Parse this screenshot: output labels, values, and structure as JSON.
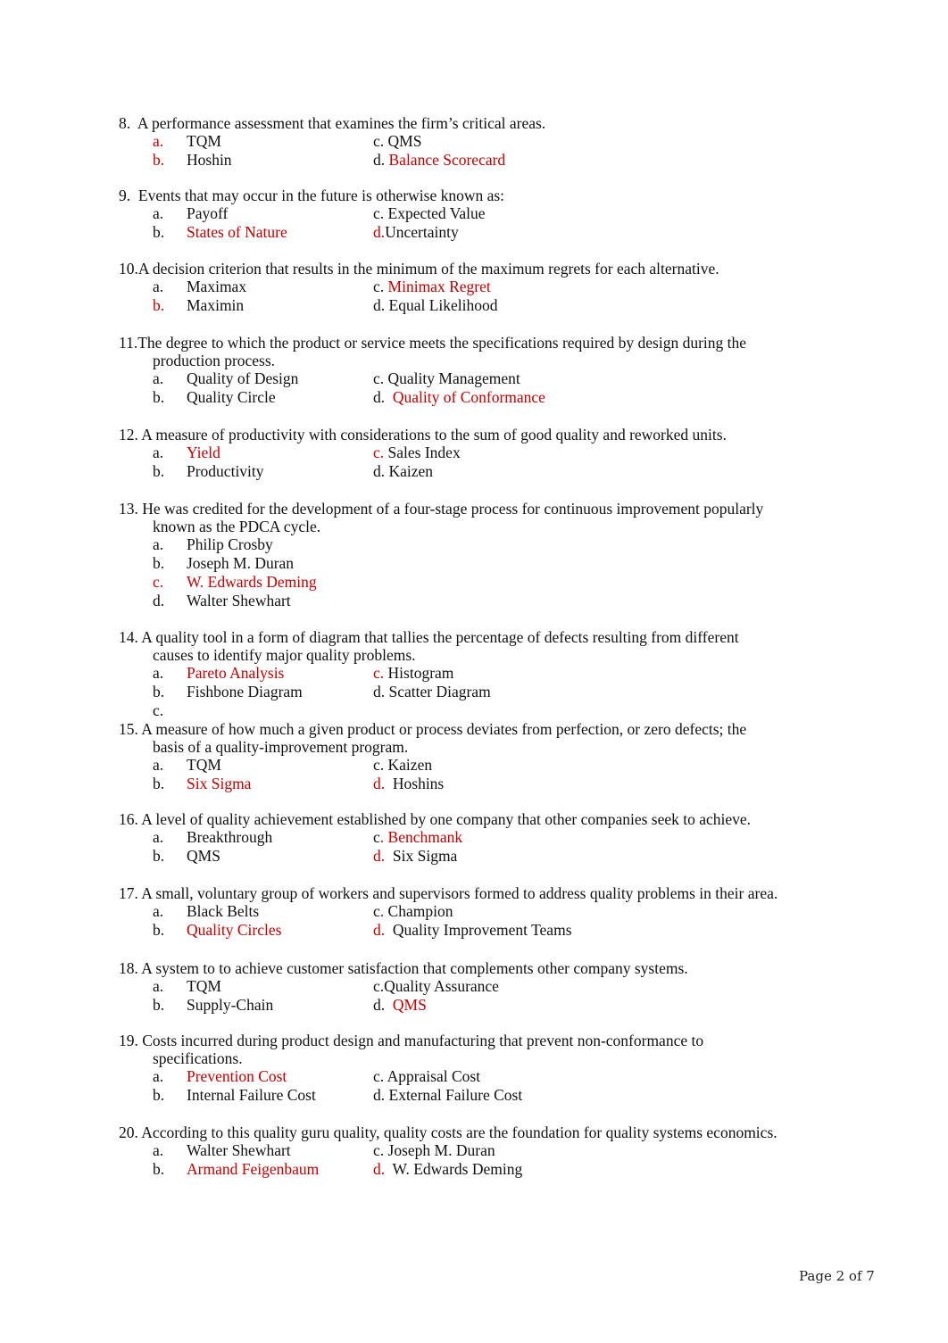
{
  "questions": [
    {
      "number": "8.",
      "stem_line1": "  A performance assessment that examines the firm’s critical areas.",
      "stem_line2": "",
      "options": [
        {
          "marker": "a.",
          "marker_color": "red",
          "text": "TQM",
          "text_color": "black",
          "col": "left"
        },
        {
          "marker": "c.",
          "marker_color": "black",
          "text": " QMS",
          "text_color": "black",
          "col": "right"
        },
        {
          "marker": "b.",
          "marker_color": "red",
          "text": "Hoshin",
          "text_color": "black",
          "col": "left"
        },
        {
          "marker": "d.",
          "marker_color": "black",
          "text": " Balance Scorecard",
          "text_color": "red",
          "col": "right"
        }
      ]
    },
    {
      "number": "9.",
      "stem_line1": "  Events that may occur in the future is otherwise known as:",
      "stem_line2": "",
      "options": [
        {
          "marker": "a.",
          "marker_color": "black",
          "text": "Payoff",
          "text_color": "black"
        },
        {
          "marker": "c.",
          "marker_color": "black",
          "text": " Expected Value",
          "text_color": "black"
        },
        {
          "marker": "b.",
          "marker_color": "black",
          "text": "States of Nature",
          "text_color": "red"
        },
        {
          "marker": "d.",
          "marker_color": "red",
          "text": "Uncertainty",
          "text_color": "black"
        }
      ]
    },
    {
      "number": "10.",
      "stem_line1": "A decision criterion that results in the minimum of the maximum regrets for each alternative.",
      "stem_line2": "",
      "options": [
        {
          "marker": "a.",
          "marker_color": "black",
          "text": "Maximax",
          "text_color": "black"
        },
        {
          "marker": "c.",
          "marker_color": "black",
          "text": " Minimax Regret",
          "text_color": "red"
        },
        {
          "marker": "b.",
          "marker_color": "red",
          "text": "Maximin",
          "text_color": "black"
        },
        {
          "marker": "d.",
          "marker_color": "black",
          "text": " Equal Likelihood",
          "text_color": "black"
        }
      ]
    },
    {
      "number": "11.",
      "stem_line1": "The degree to which the product or service meets the specifications required by design during the",
      "stem_line2": "production process.",
      "options": [
        {
          "marker": "a.",
          "marker_color": "black",
          "text": "Quality of Design",
          "text_color": "black"
        },
        {
          "marker": "c.",
          "marker_color": "black",
          "text": " Quality Management",
          "text_color": "black"
        },
        {
          "marker": "b.",
          "marker_color": "black",
          "text": "Quality Circle",
          "text_color": "black"
        },
        {
          "marker": "d.",
          "marker_color": "black",
          "text": "  Quality of Conformance",
          "text_color": "red"
        }
      ]
    },
    {
      "number": "12.",
      "stem_line1": " A measure of productivity with considerations to the sum of good quality and reworked units.",
      "stem_line2": "",
      "options": [
        {
          "marker": "a.",
          "marker_color": "black",
          "text": "Yield",
          "text_color": "red"
        },
        {
          "marker": "c.",
          "marker_color": "red",
          "text": " Sales Index",
          "text_color": "black"
        },
        {
          "marker": "b.",
          "marker_color": "black",
          "text": "Productivity",
          "text_color": "black"
        },
        {
          "marker": "d.",
          "marker_color": "black",
          "text": " Kaizen",
          "text_color": "black"
        }
      ]
    },
    {
      "number": "13.",
      "stem_line1": " He was credited for the development of a four-stage process for continuous improvement popularly",
      "stem_line2": "known as the PDCA cycle.",
      "options": [
        {
          "marker": "a.",
          "marker_color": "black",
          "text": "Philip Crosby",
          "text_color": "black"
        },
        {
          "marker": "b.",
          "marker_color": "black",
          "text": "Joseph M. Duran",
          "text_color": "black"
        },
        {
          "marker": "c.",
          "marker_color": "red",
          "text": "W. Edwards Deming",
          "text_color": "red"
        },
        {
          "marker": "d.",
          "marker_color": "black",
          "text": "Walter Shewhart",
          "text_color": "black"
        }
      ]
    },
    {
      "number": "14.",
      "stem_line1": " A quality tool in a form of diagram that tallies the percentage of defects resulting from different",
      "stem_line2": "causes to identify major quality problems.",
      "options": [
        {
          "marker": "a.",
          "marker_color": "black",
          "text": "Pareto Analysis",
          "text_color": "red"
        },
        {
          "marker": "c.",
          "marker_color": "red",
          "text": " Histogram",
          "text_color": "black"
        },
        {
          "marker": "b.",
          "marker_color": "black",
          "text": "Fishbone Diagram",
          "text_color": "black"
        },
        {
          "marker": "d.",
          "marker_color": "black",
          "text": " Scatter Diagram",
          "text_color": "black"
        },
        {
          "marker": "c.",
          "marker_color": "black",
          "text": "",
          "text_color": "black"
        }
      ]
    },
    {
      "number": "15.",
      "stem_line1": " A measure of how much a given product or process deviates from perfection, or zero defects; the",
      "stem_line2": "basis of a quality-improvement program.",
      "options": [
        {
          "marker": "a.",
          "marker_color": "black",
          "text": "TQM",
          "text_color": "black"
        },
        {
          "marker": "c.",
          "marker_color": "black",
          "text": " Kaizen",
          "text_color": "black"
        },
        {
          "marker": "b.",
          "marker_color": "black",
          "text": "Six Sigma",
          "text_color": "red"
        },
        {
          "marker": "d.",
          "marker_color": "red",
          "text": "  Hoshins",
          "text_color": "black"
        }
      ]
    },
    {
      "number": "16.",
      "stem_line1": " A level of quality achievement established by one company that other companies seek to achieve.",
      "stem_line2": "",
      "options": [
        {
          "marker": "a.",
          "marker_color": "black",
          "text": "Breakthrough",
          "text_color": "black"
        },
        {
          "marker": "c",
          "marker_suffix": ".",
          "marker_color": "black",
          "text": " Benchmank",
          "text_color": "red"
        },
        {
          "marker": "b.",
          "marker_color": "black",
          "text": "QMS",
          "text_color": "black"
        },
        {
          "marker": "d.",
          "marker_color": "red",
          "text": "  Six Sigma",
          "text_color": "black"
        }
      ]
    },
    {
      "number": "17.",
      "stem_line1": " A small, voluntary group of workers and supervisors formed to address quality problems in their area.",
      "stem_line2": "",
      "options": [
        {
          "marker": "a.",
          "marker_color": "black",
          "text": "Black Belts",
          "text_color": "black"
        },
        {
          "marker": "c",
          "marker_suffix": ".",
          "marker_color": "black",
          "text": " Champion",
          "text_color": "black"
        },
        {
          "marker": "b.",
          "marker_color": "black",
          "text": "Quality Circles",
          "text_color": "red"
        },
        {
          "marker": "d.",
          "marker_color": "red",
          "text": "  Quality Improvement Teams",
          "text_color": "black"
        }
      ]
    },
    {
      "number": "18.",
      "stem_line1": " A system to to achieve customer satisfaction that complements other company systems.",
      "stem_line2": "",
      "options": [
        {
          "marker": "a.",
          "marker_color": "black",
          "text": "TQM",
          "text_color": "black"
        },
        {
          "marker": "c.",
          "marker_color": "black",
          "text": "Quality Assurance",
          "text_color": "black"
        },
        {
          "marker": "b.",
          "marker_color": "black",
          "text": "Supply-Chain",
          "text_color": "black"
        },
        {
          "marker": "d.",
          "marker_color": "black",
          "text": "  QMS",
          "text_color": "red"
        }
      ]
    },
    {
      "number": "19.",
      "stem_line1": " Costs incurred during product design and manufacturing that prevent non-conformance to",
      "stem_line2": "specifications.",
      "options": [
        {
          "marker": "a.",
          "marker_color": "black",
          "text": "Prevention Cost",
          "text_color": "red"
        },
        {
          "marker": "c.",
          "marker_color": "black",
          "text": " Appraisal Cost",
          "text_color": "black"
        },
        {
          "marker": "b.",
          "marker_color": "black",
          "text": "Internal Failure Cost",
          "text_color": "black"
        },
        {
          "marker": "d.",
          "marker_color": "black",
          "text": " External Failure Cost",
          "text_color": "black"
        }
      ]
    },
    {
      "number": "20.",
      "stem_line1": " According to this quality guru quality, quality costs are the foundation for quality systems economics.",
      "stem_line2": "",
      "options": [
        {
          "marker": "a.",
          "marker_color": "black",
          "text": "Walter Shewhart",
          "text_color": "black"
        },
        {
          "marker": "c.",
          "marker_color": "black",
          "text": " Joseph M. Duran",
          "text_color": "black"
        },
        {
          "marker": "b.",
          "marker_color": "black",
          "text": "Armand Feigenbaum",
          "text_color": "red"
        },
        {
          "marker": "d.",
          "marker_color": "red",
          "text": "  W. Edwards Deming",
          "text_color": "black"
        }
      ]
    }
  ],
  "footer": {
    "page_label": "Page 2 of 7"
  },
  "colors": {
    "answer_red": "#c00000",
    "text": "#111111"
  }
}
